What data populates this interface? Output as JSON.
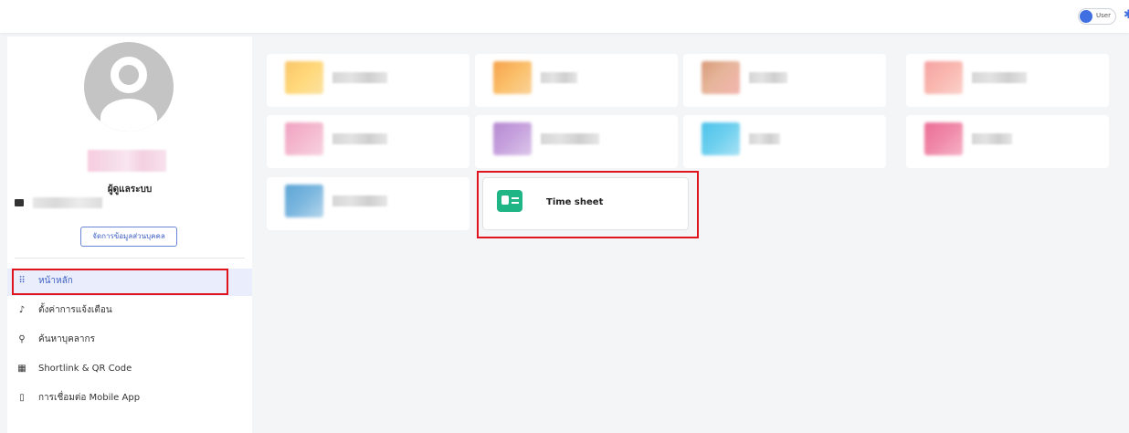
{
  "header": {
    "role_toggle_label": "User"
  },
  "sidebar": {
    "role_title": "ผู้ดูแลระบบ",
    "profile_button": "จัดการข้อมูลส่วนบุคคล",
    "nav": [
      {
        "label": "หน้าหลัก",
        "icon": "grid-icon",
        "active": true
      },
      {
        "label": "ตั้งค่าการแจ้งเตือน",
        "icon": "bell-icon",
        "active": false
      },
      {
        "label": "ค้นหาบุคลากร",
        "icon": "search-icon",
        "active": false
      },
      {
        "label": "Shortlink & QR Code",
        "icon": "qr-code-icon",
        "active": false
      },
      {
        "label": "การเชื่อมต่อ Mobile App",
        "icon": "mobile-icon",
        "active": false
      }
    ]
  },
  "apps": {
    "timesheet_label": "Time sheet"
  },
  "colors": {
    "accent": "#3f5fc4",
    "highlight": "#e0141d",
    "timesheet_icon": "#1fb584"
  }
}
